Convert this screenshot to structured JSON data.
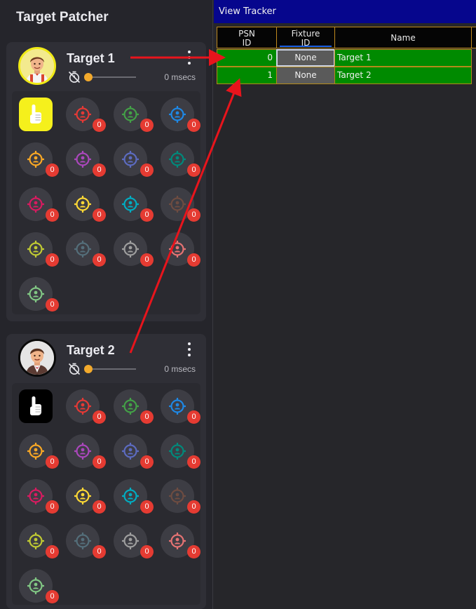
{
  "patcher": {
    "title": "Target Patcher",
    "targets": [
      {
        "name": "Target 1",
        "latency": "0 msecs",
        "latency_slider_fraction": 0.0,
        "avatar_ring_color": "#f0ea16",
        "hand_tile_color": "#f5f01c",
        "hand_icon_color": "#ffffff",
        "fixtures": [
          {
            "icon": "crosshair-person-icon",
            "color": "#e53935",
            "count": "0"
          },
          {
            "icon": "crosshair-person-icon",
            "color": "#43a047",
            "count": "0"
          },
          {
            "icon": "crosshair-person-icon",
            "color": "#1e88e5",
            "count": "0"
          },
          {
            "icon": "crosshair-person-icon",
            "color": "#f9a825",
            "count": "0"
          },
          {
            "icon": "crosshair-person-icon",
            "color": "#ab47bc",
            "count": "0"
          },
          {
            "icon": "crosshair-person-icon",
            "color": "#5c6bc0",
            "count": "0"
          },
          {
            "icon": "crosshair-person-icon",
            "color": "#00897b",
            "count": "0"
          },
          {
            "icon": "crosshair-person-icon",
            "color": "#d81b60",
            "count": "0"
          },
          {
            "icon": "crosshair-person-icon",
            "color": "#fdd835",
            "count": "0"
          },
          {
            "icon": "crosshair-person-icon",
            "color": "#00acc1",
            "count": "0"
          },
          {
            "icon": "crosshair-person-icon",
            "color": "#6d4c41",
            "count": "0"
          },
          {
            "icon": "crosshair-person-icon",
            "color": "#c0ca33",
            "count": "0"
          },
          {
            "icon": "crosshair-person-icon",
            "color": "#546e7a",
            "count": "0"
          },
          {
            "icon": "crosshair-person-icon",
            "color": "#9e9e9e",
            "count": "0"
          },
          {
            "icon": "crosshair-person-icon",
            "color": "#e57373",
            "count": "0"
          },
          {
            "icon": "crosshair-person-icon",
            "color": "#81c784",
            "count": "0"
          }
        ]
      },
      {
        "name": "Target 2",
        "latency": "0 msecs",
        "latency_slider_fraction": 0.0,
        "avatar_ring_color": "#0a0a0a",
        "hand_tile_color": "#000000",
        "hand_icon_color": "#ffffff",
        "fixtures": [
          {
            "icon": "crosshair-person-icon",
            "color": "#e53935",
            "count": "0"
          },
          {
            "icon": "crosshair-person-icon",
            "color": "#43a047",
            "count": "0"
          },
          {
            "icon": "crosshair-person-icon",
            "color": "#1e88e5",
            "count": "0"
          },
          {
            "icon": "crosshair-person-icon",
            "color": "#f9a825",
            "count": "0"
          },
          {
            "icon": "crosshair-person-icon",
            "color": "#ab47bc",
            "count": "0"
          },
          {
            "icon": "crosshair-person-icon",
            "color": "#5c6bc0",
            "count": "0"
          },
          {
            "icon": "crosshair-person-icon",
            "color": "#00897b",
            "count": "0"
          },
          {
            "icon": "crosshair-person-icon",
            "color": "#d81b60",
            "count": "0"
          },
          {
            "icon": "crosshair-person-icon",
            "color": "#fdd835",
            "count": "0"
          },
          {
            "icon": "crosshair-person-icon",
            "color": "#00acc1",
            "count": "0"
          },
          {
            "icon": "crosshair-person-icon",
            "color": "#6d4c41",
            "count": "0"
          },
          {
            "icon": "crosshair-person-icon",
            "color": "#c0ca33",
            "count": "0"
          },
          {
            "icon": "crosshair-person-icon",
            "color": "#546e7a",
            "count": "0"
          },
          {
            "icon": "crosshair-person-icon",
            "color": "#9e9e9e",
            "count": "0"
          },
          {
            "icon": "crosshair-person-icon",
            "color": "#e57373",
            "count": "0"
          },
          {
            "icon": "crosshair-person-icon",
            "color": "#81c784",
            "count": "0"
          }
        ]
      }
    ],
    "slider_color": "#f3aa2c",
    "badge_color": "#e53b32"
  },
  "tracker": {
    "title": "View Tracker",
    "title_bar_color": "#06068d",
    "columns": {
      "psn_id": "PSN\nID",
      "fixture_id": "Fixture\nID",
      "name": "Name"
    },
    "rows": [
      {
        "psn_id": "0",
        "fixture_id": "None",
        "name": "Target 1"
      },
      {
        "psn_id": "1",
        "fixture_id": "None",
        "name": "Target 2"
      }
    ],
    "row_color": "#008a00",
    "header_border_color": "#c08a1e"
  },
  "annotation_color": "#e8141c"
}
